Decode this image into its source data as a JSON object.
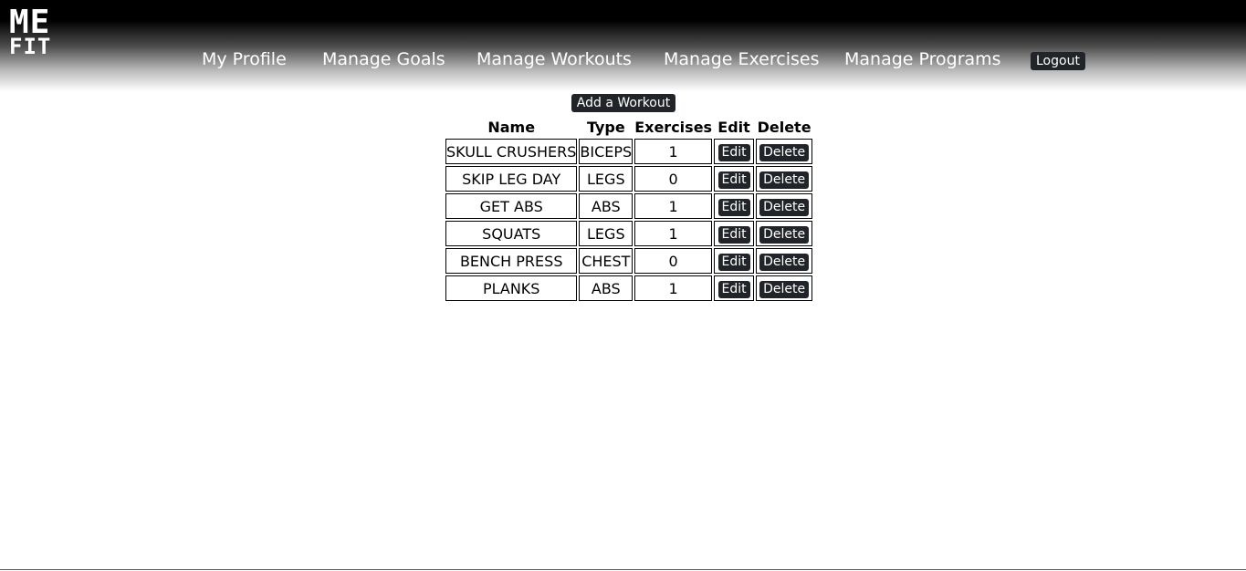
{
  "logo": {
    "line1": "ME",
    "line2": "FIT"
  },
  "nav": {
    "items": [
      {
        "label": "My Profile"
      },
      {
        "label": "Manage Goals"
      },
      {
        "label": "Manage Workouts"
      },
      {
        "label": "Manage Exercises"
      },
      {
        "label": "Manage Programs"
      }
    ],
    "logout_label": "Logout"
  },
  "main": {
    "add_button_label": "Add a Workout",
    "table": {
      "headers": {
        "name": "Name",
        "type": "Type",
        "exercises": "Exercises",
        "edit": "Edit",
        "delete": "Delete"
      },
      "edit_label": "Edit",
      "delete_label": "Delete",
      "rows": [
        {
          "name": "SKULL CRUSHERS",
          "type": "BICEPS",
          "exercises": "1"
        },
        {
          "name": "SKIP LEG DAY",
          "type": "LEGS",
          "exercises": "0"
        },
        {
          "name": "GET ABS",
          "type": "ABS",
          "exercises": "1"
        },
        {
          "name": "SQUATS",
          "type": "LEGS",
          "exercises": "1"
        },
        {
          "name": "BENCH PRESS",
          "type": "CHEST",
          "exercises": "0"
        },
        {
          "name": "PLANKS",
          "type": "ABS",
          "exercises": "1"
        }
      ]
    }
  },
  "colors": {
    "button_bg": "#212529",
    "header_top": "#000000"
  }
}
